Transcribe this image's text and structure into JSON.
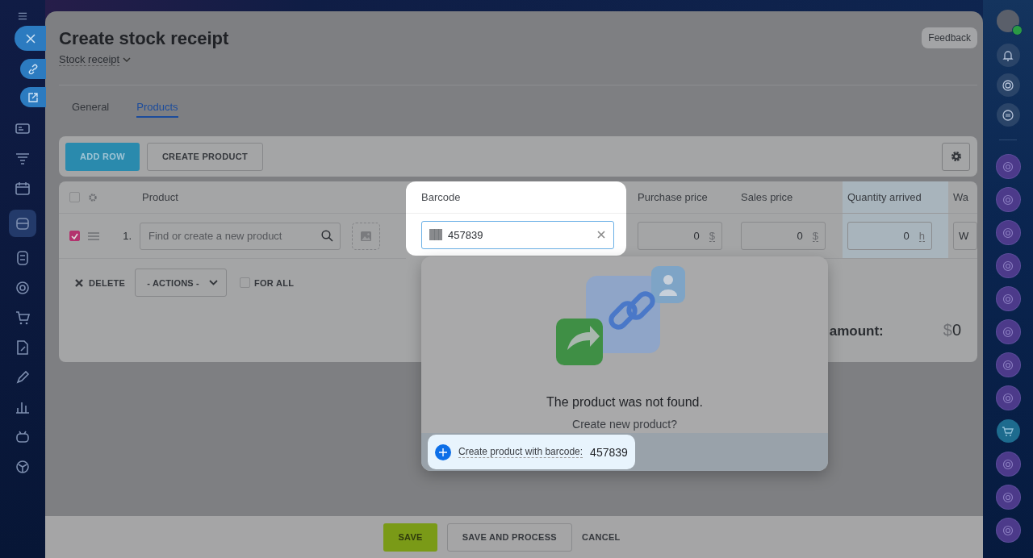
{
  "header": {
    "title": "Create stock receipt",
    "doc_type": "Stock receipt",
    "feedback": "Feedback"
  },
  "tabs": [
    {
      "label": "General",
      "selected": false
    },
    {
      "label": "Products",
      "selected": true
    }
  ],
  "toolbar": {
    "buttons": [
      {
        "label": "ADD ROW",
        "kind": "primary"
      },
      {
        "label": "CREATE PRODUCT",
        "kind": "secondary"
      }
    ]
  },
  "table": {
    "select_all": {
      "checked": false
    },
    "columns": [
      "Product",
      "Barcode",
      "Purchase price",
      "Sales price",
      "Quantity arrived",
      "Wa"
    ],
    "rows": [
      {
        "checked": true,
        "number": "1.",
        "product_placeholder": "Find or create a new product",
        "barcode": "457839",
        "purchase_price": "0",
        "purchase_currency": "$",
        "sales_price": "0",
        "sales_currency": "$",
        "quantity": "0",
        "unit": "h",
        "warehouse": "W"
      }
    ]
  },
  "row_actions": {
    "delete": "DELETE",
    "actions": "- ACTIONS -",
    "for_all": {
      "label": "FOR ALL",
      "checked": false
    }
  },
  "total": {
    "label": "amount:",
    "currency": "$",
    "value": "0"
  },
  "barcode_popup": {
    "title": "The product was not found.",
    "subtitle": "Create new product?",
    "action": {
      "label": "Create product with barcode:",
      "barcode": "457839"
    }
  },
  "footer": {
    "buttons": [
      {
        "label": "SAVE",
        "kind": "primary"
      },
      {
        "label": "SAVE AND PROCESS",
        "kind": "secondary"
      },
      {
        "label": "CANCEL",
        "kind": "link"
      }
    ]
  }
}
